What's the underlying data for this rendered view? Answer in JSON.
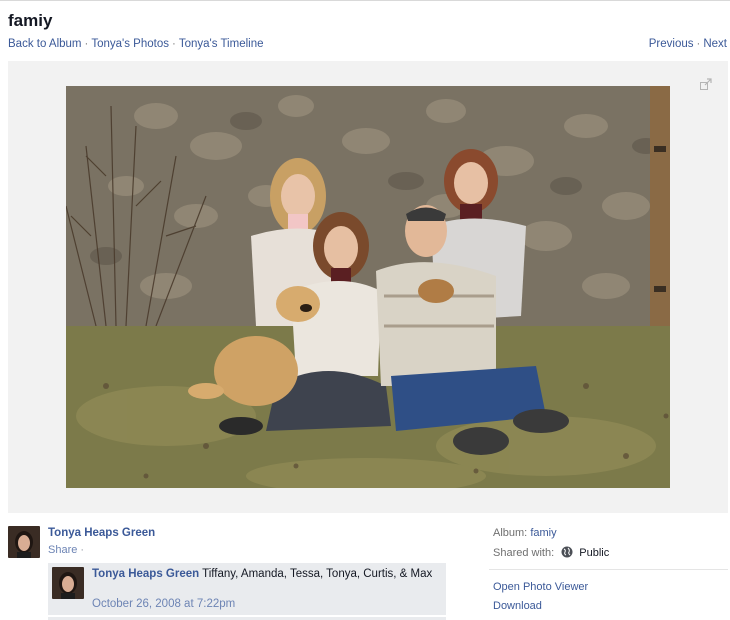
{
  "page": {
    "title": "famiy"
  },
  "breadcrumbs": [
    "Back to Album",
    "Tonya's Photos",
    "Tonya's Timeline"
  ],
  "breadcrumb_separator": "·",
  "pager": {
    "previous": "Previous",
    "next": "Next",
    "separator": "·"
  },
  "owner": {
    "name": "Tonya Heaps Green",
    "share_label": "Share",
    "share_separator": "·"
  },
  "comment": {
    "author": "Tonya Heaps Green",
    "text": "Tiffany, Amanda, Tessa, Tonya, Curtis, & Max",
    "timestamp": "October 26, 2008 at 7:22pm"
  },
  "sidebar": {
    "album_label": "Album:",
    "album_value": "famiy",
    "shared_label": "Shared with:",
    "shared_value": "Public",
    "shared_icon": "globe-icon",
    "open_viewer": "Open Photo Viewer",
    "download": "Download"
  },
  "icons": {
    "expand": "expand-icon"
  },
  "colors": {
    "link": "#3b5998",
    "stage_bg": "#f2f2f2",
    "comment_bg": "#e9ebee"
  }
}
